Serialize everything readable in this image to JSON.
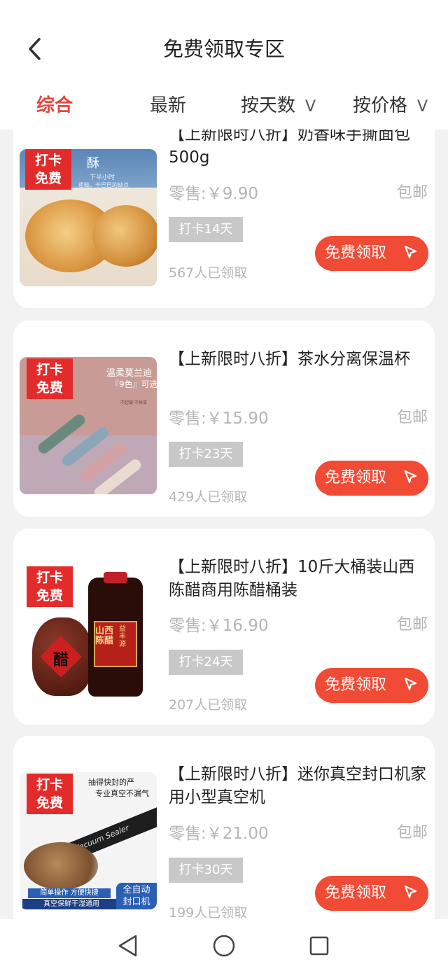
{
  "header": {
    "title": "免费领取专区",
    "back_icon": "chevron-left-icon"
  },
  "tabs": [
    {
      "label": "综合",
      "active": true
    },
    {
      "label": "最新",
      "active": false
    },
    {
      "label": "按天数",
      "active": false,
      "chevron": "V"
    },
    {
      "label": "按价格",
      "active": false,
      "chevron": "V"
    }
  ],
  "badge_text": [
    "打卡",
    "免费"
  ],
  "colors": {
    "accent": "#e9453d",
    "button": "#f14a35",
    "badge": "#e42b2b",
    "muted": "#b5b5b5"
  },
  "products": [
    {
      "name": "【上新限时八折】奶香味手撕面包500g",
      "price": "零售:￥9.90",
      "shipping": "包邮",
      "days": "打卡14天",
      "claimed": "567人已领取",
      "button": "免费领取",
      "image_text": [
        "酥",
        "下半小时",
        "粗糙，干巴巴的缺点"
      ]
    },
    {
      "name": "【上新限时八折】茶水分离保温杯",
      "price": "零售:￥15.90",
      "shipping": "包邮",
      "days": "打卡23天",
      "claimed": "429人已领取",
      "button": "免费领取",
      "image_text": [
        "温柔莫兰迪",
        "『9色』可选",
        "不起皱 不掉漆"
      ]
    },
    {
      "name": "【上新限时八折】10斤大桶装山西陈醋商用陈醋桶装",
      "price": "零售:￥16.90",
      "shipping": "包邮",
      "days": "打卡24天",
      "claimed": "207人已领取",
      "button": "免费领取",
      "image_text": [
        "醋",
        "山西陈醋",
        "益丰源"
      ]
    },
    {
      "name": "【上新限时八折】迷你真空封口机家用小型真空机",
      "price": "零售:￥21.00",
      "shipping": "包邮",
      "days": "打卡30天",
      "claimed": "199人已领取",
      "button": "免费领取",
      "image_text": [
        "抽得快封的严",
        "专业真空不漏气",
        "Vacuum Sealer",
        "简单操作 方便快捷",
        "真空保鲜干湿通用",
        "全自动",
        "封口机"
      ]
    }
  ],
  "navbar": {
    "back": "back-triangle-icon",
    "home": "home-circle-icon",
    "recents": "recents-square-icon"
  }
}
